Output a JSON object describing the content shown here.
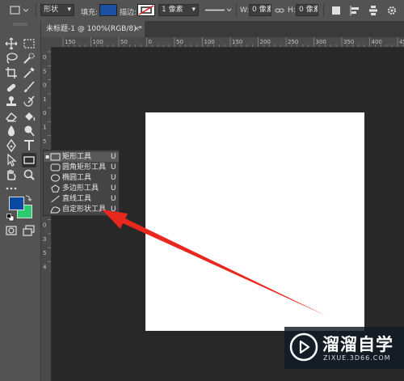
{
  "options_bar": {
    "tool_mode": "形状",
    "fill_label": "填充:",
    "fill_color": "#1c4fa0",
    "stroke_label": "描边:",
    "stroke_width_value": "1 像素",
    "width_label": "W:",
    "width_value": "0 像素",
    "height_label": "H:",
    "height_value": "0 像素"
  },
  "document": {
    "tab_title": "未标题-1 @ 100%(RGB/8) *",
    "tab_close": "×",
    "canvas_color": "#ffffff"
  },
  "ruler": {
    "top_ticks": [
      "150",
      "100",
      "50",
      "0",
      "50",
      "100",
      "150",
      "200",
      "250",
      "300",
      "350",
      "400",
      "450"
    ],
    "left_ticks": [
      "0",
      "5",
      "0",
      "1",
      "0",
      "1",
      "5",
      "2",
      "0",
      "2",
      "5",
      "3",
      "0",
      "3",
      "5",
      "4"
    ]
  },
  "colors": {
    "foreground": "#0b4aa2",
    "background": "#2ecc71",
    "annotation_arrow": "#e8281f"
  },
  "shape_flyout": {
    "items": [
      {
        "label": "矩形工具",
        "shortcut": "U",
        "icon": "rectangle-icon",
        "selected": true,
        "marker": "▪"
      },
      {
        "label": "圆角矩形工具",
        "shortcut": "U",
        "icon": "rounded-rectangle-icon",
        "selected": false,
        "marker": ""
      },
      {
        "label": "椭圆工具",
        "shortcut": "U",
        "icon": "ellipse-icon",
        "selected": false,
        "marker": ""
      },
      {
        "label": "多边形工具",
        "shortcut": "U",
        "icon": "polygon-icon",
        "selected": false,
        "marker": ""
      },
      {
        "label": "直线工具",
        "shortcut": "U",
        "icon": "line-icon",
        "selected": false,
        "marker": ""
      },
      {
        "label": "自定形状工具",
        "shortcut": "U",
        "icon": "custom-shape-icon",
        "selected": false,
        "marker": ""
      }
    ]
  },
  "watermark": {
    "title": "溜溜自学",
    "subtitle": "ZIXUE.3D66.COM"
  }
}
